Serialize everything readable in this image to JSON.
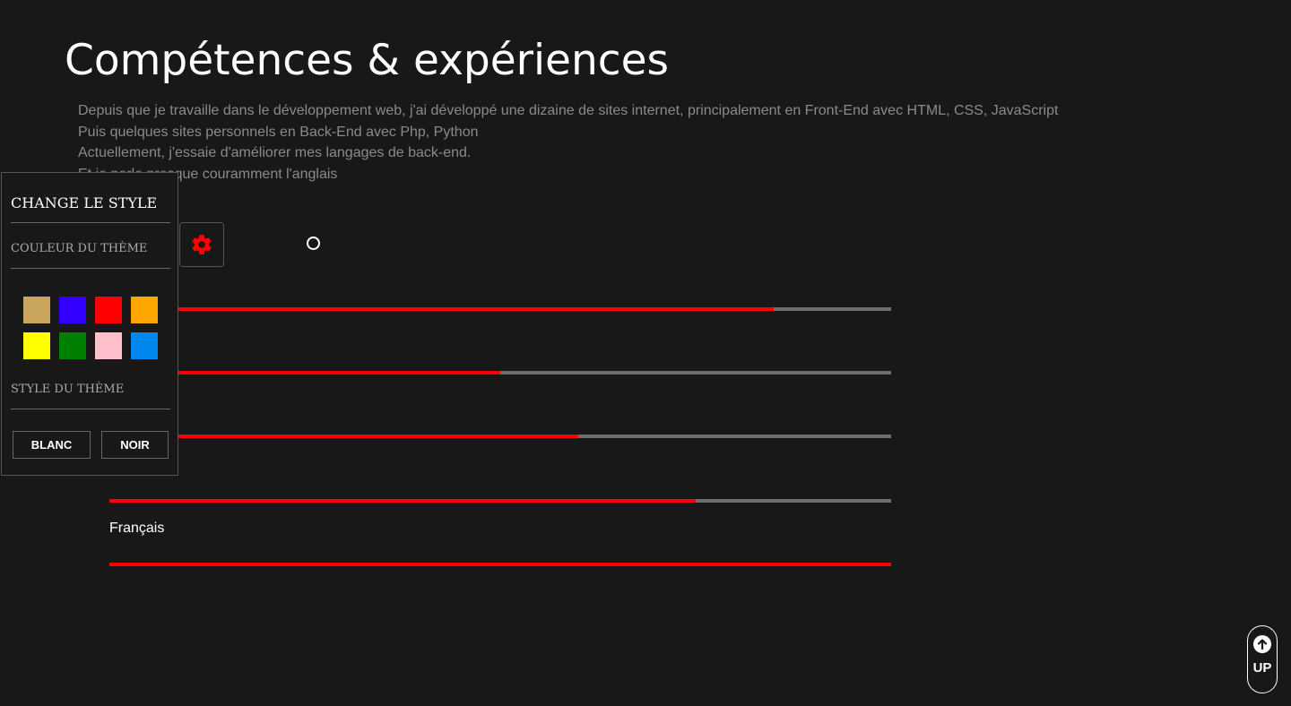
{
  "header": {
    "title": "Compétences & expériences"
  },
  "intro": {
    "lines": [
      "Depuis que je travaille dans le développement web, j'ai développé une dizaine de sites internet, principalement en Front-End avec HTML, CSS, JavaScript",
      "Puis quelques sites personnels en Back-End avec Php, Python",
      "Actuellement, j'essaie d'améliorer mes langages de back-end.",
      "Et je parle presque couramment l'anglais"
    ]
  },
  "skills": [
    {
      "label": "",
      "level": 0.85
    },
    {
      "label": "",
      "level": 0.5
    },
    {
      "label": "",
      "level": 0.6
    },
    {
      "label": "",
      "level": 0.75
    },
    {
      "label": "Français",
      "level": 1.0
    }
  ],
  "style_switcher": {
    "title": "CHANGE LE STYLE",
    "color_section": "COULEUR DU THÈME",
    "style_section": "STYLE DU THÈME",
    "colors": [
      "#c8a55a",
      "#3300ff",
      "#ff0000",
      "#ffa500",
      "#ffff00",
      "#008000",
      "#ffc0cb",
      "#0088ee"
    ],
    "buttons": {
      "light": "BLANC",
      "dark": "NOIR"
    },
    "toggle_icon": "gear-icon"
  },
  "accent_color": "#ff0000",
  "scroll_up": {
    "label": "UP",
    "icon": "arrow-up-circle-icon"
  }
}
